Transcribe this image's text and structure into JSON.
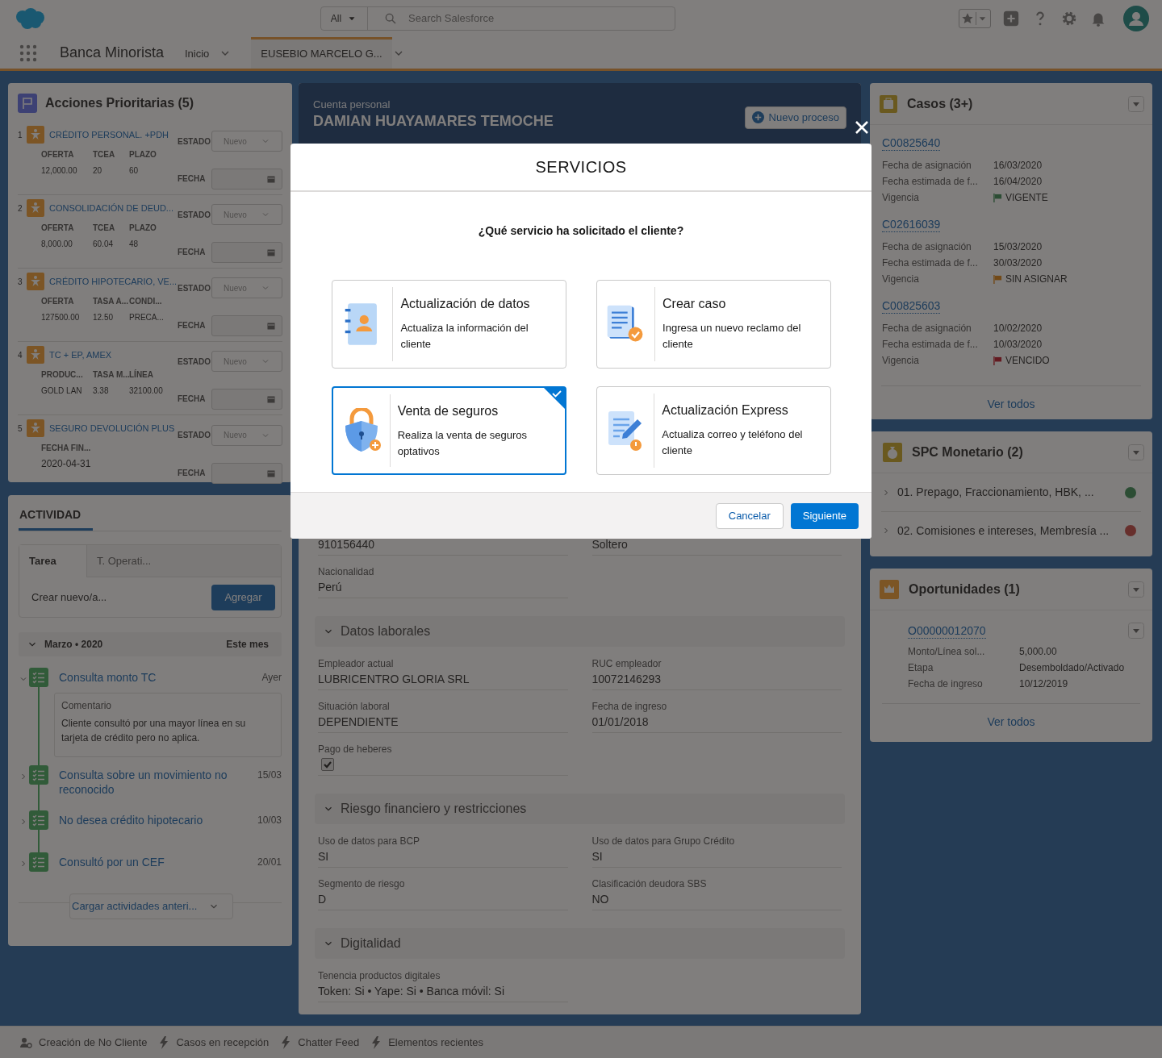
{
  "header": {
    "search_scope": "All",
    "search_placeholder": "Search Salesforce",
    "app_name": "Banca Minorista",
    "nav_items": [
      {
        "label": "Inicio",
        "selected": false
      },
      {
        "label": "EUSEBIO MARCELO G...",
        "selected": true
      }
    ]
  },
  "priority_actions": {
    "title": "Acciones Prioritarias (5)",
    "items": [
      {
        "number": "1",
        "title": "CRÉDITO PERSONAL. +PDH",
        "status_label": "ESTADO",
        "date_label": "FECHA",
        "status": "Nuevo",
        "fields": [
          {
            "label": "OFERTA",
            "value": "12,000.00"
          },
          {
            "label": "TCEA",
            "value": "20"
          },
          {
            "label": "PLAZO",
            "value": "60"
          }
        ]
      },
      {
        "number": "2",
        "title": "CONSOLIDACIÓN DE DEUD...",
        "status_label": "ESTADO",
        "date_label": "FECHA",
        "status": "Nuevo",
        "fields": [
          {
            "label": "OFERTA",
            "value": "8,000.00"
          },
          {
            "label": "TCEA",
            "value": "60.04"
          },
          {
            "label": "PLAZO",
            "value": "48"
          }
        ]
      },
      {
        "number": "3",
        "title": "CRÉDITO HIPOTECARIO, VE...",
        "status_label": "ESTADO",
        "date_label": "FECHA",
        "status": "Nuevo",
        "fields": [
          {
            "label": "OFERTA",
            "value": "127500.00"
          },
          {
            "label": "TASA A...",
            "value": "12.50"
          },
          {
            "label": "CONDI...",
            "value": "PRECA..."
          }
        ]
      },
      {
        "number": "4",
        "title": "TC + EP, AMEX",
        "status_label": "ESTADO",
        "date_label": "FECHA",
        "status": "Nuevo",
        "fields": [
          {
            "label": "PRODUC...",
            "value": "GOLD LAN"
          },
          {
            "label": "TASA M...",
            "value": "3.38"
          },
          {
            "label": "LÍNEA",
            "value": "32100.00"
          }
        ]
      },
      {
        "number": "5",
        "title": "SEGURO DEVOLUCIÓN PLUS",
        "status_label": "ESTADO",
        "date_label": "FECHA",
        "status": "Nuevo",
        "fields": [
          {
            "label": "FECHA FIN...",
            "value": "2020-04-31"
          }
        ]
      }
    ]
  },
  "activity": {
    "tab": "ACTIVIDAD",
    "composer_tabs": [
      {
        "label": "Tarea",
        "selected": true
      },
      {
        "label": "T. Operati...",
        "selected": false
      }
    ],
    "new_placeholder": "Crear nuevo/a...",
    "add_button": "Agregar",
    "month": "Marzo • 2020",
    "period": "Este mes",
    "items": [
      {
        "title": "Consulta monto TC",
        "date": "Ayer",
        "expanded": true,
        "comment_label": "Comentario",
        "comment": "Cliente consultó por una mayor línea en su tarjeta de crédito pero no aplica."
      },
      {
        "title": "Consulta sobre un movimiento no reconocido",
        "date": "15/03",
        "expanded": false
      },
      {
        "title": "No desea crédito hipotecario",
        "date": "10/03",
        "expanded": false
      },
      {
        "title": "Consultó por un CEF",
        "date": "20/01",
        "expanded": false
      }
    ],
    "load_more": "Cargar actividades anteri..."
  },
  "account": {
    "type": "Cuenta personal",
    "name": "DAMIAN HUAYAMARES TEMOCHE",
    "action": "Nuevo proceso",
    "fields": [
      {
        "kind": "text",
        "value": "910156440"
      },
      {
        "kind": "text",
        "value": "Soltero"
      },
      {
        "kind": "text",
        "label": "Nacionalidad",
        "value": "Perú"
      }
    ],
    "sections": [
      {
        "title": "Datos laborales",
        "expanded": true,
        "fields": [
          {
            "kind": "text",
            "label": "Empleador actual",
            "value": "LUBRICENTRO GLORIA SRL"
          },
          {
            "kind": "text",
            "label": "RUC empleador",
            "value": "10072146293"
          },
          {
            "kind": "text",
            "label": "Situación laboral",
            "value": "DEPENDIENTE"
          },
          {
            "kind": "text",
            "label": "Fecha de ingreso",
            "value": "01/01/2018"
          },
          {
            "kind": "checkbox",
            "label": "Pago de heberes",
            "checked": true
          }
        ]
      },
      {
        "title": "Riesgo financiero y restricciones",
        "expanded": true,
        "fields": [
          {
            "kind": "text",
            "label": "Uso de datos para BCP",
            "value": "SI"
          },
          {
            "kind": "text",
            "label": "Uso de datos para Grupo Crédito",
            "value": "SI"
          },
          {
            "kind": "text",
            "label": "Segmento de riesgo",
            "value": "D"
          },
          {
            "kind": "text",
            "label": "Clasificación deudora SBS",
            "value": "NO"
          }
        ]
      },
      {
        "title": "Digitalidad",
        "expanded": true,
        "fields": [
          {
            "kind": "text",
            "label": "Tenencia productos digitales",
            "value": "Token: Si • Yape: Si • Banca móvil: Si"
          }
        ]
      }
    ]
  },
  "cases": {
    "title": "Casos (3+)",
    "view_all": "Ver todos",
    "items": [
      {
        "id": "C00825640",
        "rows": [
          {
            "label": "Fecha de asignación",
            "value": "16/03/2020"
          },
          {
            "label": "Fecha estimada de f...",
            "value": "16/04/2020"
          },
          {
            "label": "Vigencia",
            "value": "VIGENTE",
            "color": "#2c4d34"
          }
        ]
      },
      {
        "id": "C02616039",
        "rows": [
          {
            "label": "Fecha de asignación",
            "value": "15/03/2020"
          },
          {
            "label": "Fecha estimada de f...",
            "value": "30/03/2020"
          },
          {
            "label": "Vigencia",
            "value": "SIN ASIGNAR",
            "color": "#724917"
          }
        ]
      },
      {
        "id": "C00825603",
        "rows": [
          {
            "label": "Fecha de asignación",
            "value": "10/02/2020"
          },
          {
            "label": "Fecha estimada de f...",
            "value": "10/03/2020"
          },
          {
            "label": "Vigencia",
            "value": "VENCIDO",
            "color": "#641a20"
          }
        ]
      }
    ]
  },
  "spc": {
    "title": "SPC Monetario (2)",
    "items": [
      {
        "label": "01. Prepago, Fraccionamiento, HBK, ...",
        "color": "#2c4d34"
      },
      {
        "label": "02. Comisiones e intereses, Membresía ...",
        "color": "#672f2c"
      }
    ]
  },
  "opportunities": {
    "title": "Oportunidades (1)",
    "view_all": "Ver todos",
    "items": [
      {
        "id": "O00000012070",
        "rows": [
          {
            "label": "Monto/Línea sol...",
            "value": "5,000.00"
          },
          {
            "label": "Etapa",
            "value": "Desemboldado/Activado"
          },
          {
            "label": "Fecha de ingreso",
            "value": "10/12/2019"
          }
        ]
      }
    ]
  },
  "utility_bar": [
    {
      "kind": "person",
      "label": "Creación de No Cliente"
    },
    {
      "kind": "bolt",
      "label": "Casos en recepción"
    },
    {
      "kind": "bolt",
      "label": "Chatter Feed"
    },
    {
      "kind": "bolt",
      "label": "Elementos recientes"
    }
  ],
  "modal": {
    "title": "SERVICIOS",
    "question": "¿Qué servicio ha solicitado el cliente?",
    "options": [
      {
        "kind": "contact",
        "title": "Actualización de datos",
        "description": "Actualiza la información del cliente",
        "selected": false
      },
      {
        "kind": "case",
        "title": "Crear caso",
        "description": "Ingresa un nuevo reclamo del cliente",
        "selected": false
      },
      {
        "kind": "insurance",
        "title": "Venta de seguros",
        "description": "Realiza la venta de seguros optativos",
        "selected": true
      },
      {
        "kind": "express",
        "title": "Actualización Express",
        "description": "Actualiza correo y teléfono del cliente",
        "selected": false
      }
    ],
    "cancel": "Cancelar",
    "next": "Siguiente"
  }
}
